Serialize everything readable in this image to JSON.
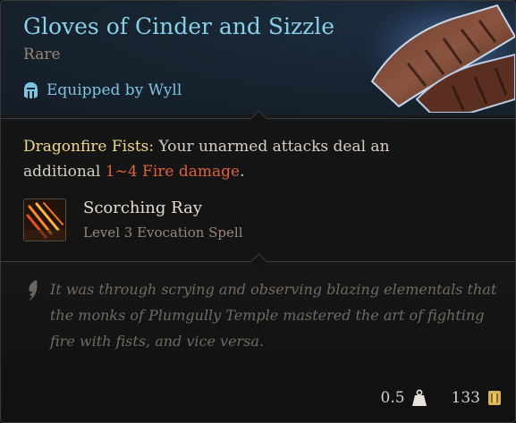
{
  "item": {
    "title": "Gloves of Cinder and Sizzle",
    "rarity": "Rare",
    "equipped_by": "Equipped by Wyll"
  },
  "passive": {
    "name": "Dragonfire Fists:",
    "text_before": " Your unarmed attacks deal an additional ",
    "damage": "1~4 Fire damage",
    "text_after": "."
  },
  "spell": {
    "name": "Scorching Ray",
    "level": "Level 3 Evocation Spell"
  },
  "lore": "It was through scrying and observing blazing elementals that the monks of Plumgully Temple mastered the art of fighting fire with fists, and vice versa.",
  "footer": {
    "weight": "0.5",
    "value": "133"
  },
  "icons": [
    "gloves-item-art",
    "helmet-icon",
    "scorching-ray-icon",
    "quill-icon",
    "weight-icon",
    "gold-icon"
  ],
  "colors": {
    "title": "#87d0e8",
    "equipped": "#7cc4df",
    "passive_name": "#f0d88e",
    "damage": "#e2603a",
    "lore": "#716a62"
  }
}
